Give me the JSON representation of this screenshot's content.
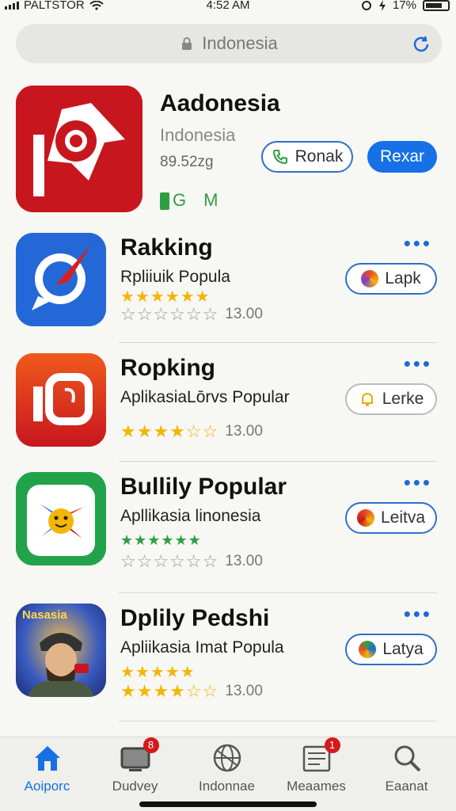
{
  "status_bar": {
    "carrier": "PALTSTOR",
    "time": "4:52 AM",
    "battery": "17%"
  },
  "search": {
    "text": "Indonesia"
  },
  "featured": {
    "title": "Aadonesia",
    "subtitle": "Indonesia",
    "size": "89.52zg",
    "tag1": "G",
    "tag2": "M",
    "secondary_button": "Ronak",
    "primary_button": "Rexar",
    "icon": "pinwheel-logo-icon"
  },
  "apps": [
    {
      "name": "Rakking",
      "description": "Rpliiuik Popula",
      "stars_top": "★★★★★★",
      "stars_bottom": "☆☆☆☆☆☆",
      "rating": "13.00",
      "button": "Lapk",
      "more": "•••",
      "icon": "compass-chat-icon"
    },
    {
      "name": "Ropking",
      "description": "AplikasiaLōrvs Popular",
      "stars_bottom": "★★★★☆☆",
      "rating": "13.00",
      "button": "Lerke",
      "more": "•••",
      "icon": "photo-frame-icon"
    },
    {
      "name": "Bullily Popular",
      "description": "Apllikasia linonesia",
      "stars_top": "★★★★★★",
      "stars_bottom": "☆☆☆☆☆☆",
      "rating": "13.00",
      "button": "Leitva",
      "more": "•••",
      "icon": "pinwheel-smiley-icon"
    },
    {
      "name": "Dplily Pedshi",
      "description": "Apliikasia Imat Popula",
      "stars_top": "★★★★★",
      "stars_bottom": "★★★★☆☆",
      "rating": "13.00",
      "button": "Latya",
      "more": "•••",
      "icon_label": "Nasasia",
      "icon": "game-character-icon"
    }
  ],
  "tabs": [
    {
      "label": "Aoiporc",
      "icon": "home-icon",
      "active": true
    },
    {
      "label": "Dudvey",
      "icon": "tv-icon",
      "badge": "8"
    },
    {
      "label": "Indonnae",
      "icon": "globe-icon"
    },
    {
      "label": "Meaames",
      "icon": "news-icon",
      "badge": "1"
    },
    {
      "label": "Eaanat",
      "icon": "search-icon"
    }
  ],
  "colors": {
    "accent": "#1670e6",
    "featured_icon_bg": "#c8161e",
    "star_yellow": "#f2b705",
    "star_green": "#2e9e44",
    "badge": "#d51a1a"
  }
}
